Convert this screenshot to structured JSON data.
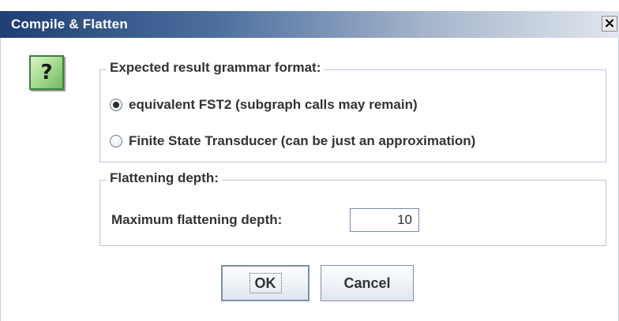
{
  "window": {
    "title": "Compile & Flatten",
    "close_glyph": "✕"
  },
  "icon": {
    "name": "question-icon",
    "glyph": "?",
    "color": "#8fd07a"
  },
  "format_group": {
    "title": "Expected result grammar format:",
    "options": [
      {
        "label": "equivalent FST2 (subgraph calls may remain)",
        "checked": true
      },
      {
        "label": "Finite State Transducer (can be just an approximation)",
        "checked": false
      }
    ]
  },
  "depth_group": {
    "title": "Flattening depth:",
    "label": "Maximum flattening depth:",
    "value": "10"
  },
  "buttons": {
    "ok": "OK",
    "cancel": "Cancel"
  }
}
